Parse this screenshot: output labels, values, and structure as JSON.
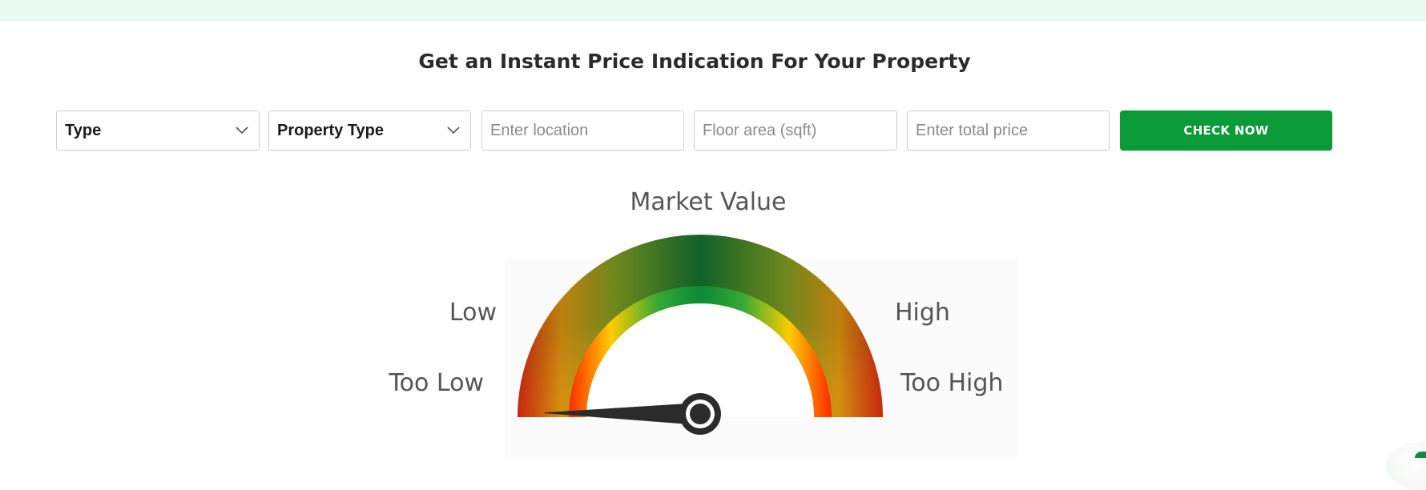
{
  "page": {
    "title": "Get an Instant Price Indication For Your Property"
  },
  "form": {
    "type_select": {
      "value": "Type",
      "icon": "chevron-down-icon"
    },
    "property_type_select": {
      "value": "Property Type",
      "icon": "chevron-down-icon"
    },
    "location_input": {
      "value": "",
      "placeholder": "Enter location"
    },
    "floor_area_input": {
      "value": "",
      "placeholder": "Floor area (sqft)"
    },
    "total_price_input": {
      "value": "",
      "placeholder": "Enter total price"
    },
    "submit_label": "CHECK NOW"
  },
  "gauge": {
    "labels": {
      "top": "Market Value",
      "left_mid": "Low",
      "right_mid": "High",
      "left_bottom": "Too Low",
      "right_bottom": "Too High"
    },
    "needle_position": 0.02
  },
  "colors": {
    "accent": "#0a9a37",
    "top_band": "#eafaf3",
    "gauge_green": "#0f7a34",
    "gauge_yellow": "#f2c200",
    "gauge_red": "#e52a0a"
  }
}
